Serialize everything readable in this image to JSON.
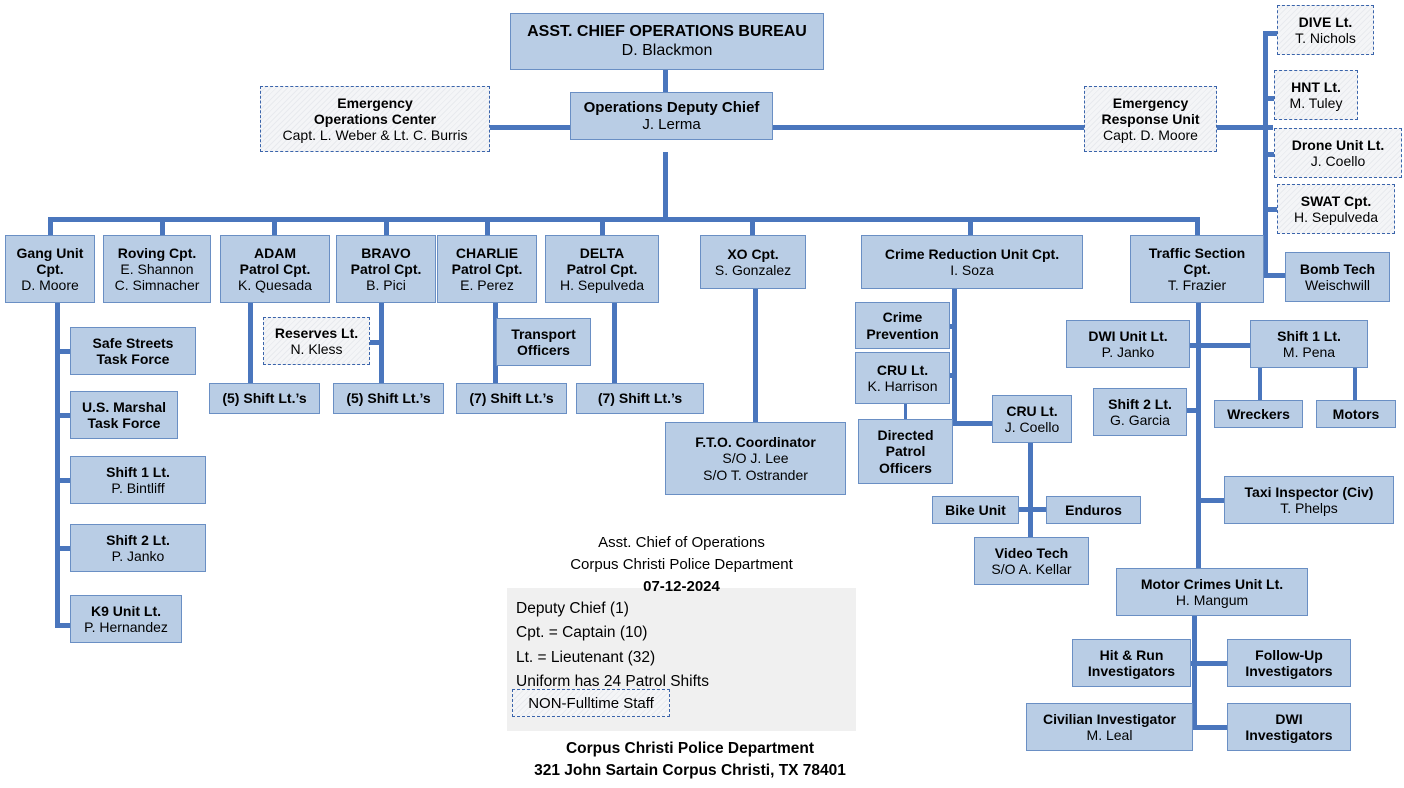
{
  "meta": {
    "colors": {
      "box_fill": "#b9cde5",
      "box_border": "#6a8fc4",
      "line": "#4a76bd",
      "legend_panel": "#f0f0f0",
      "dashed_border": "#3a64ab"
    }
  },
  "chart_data": {
    "type": "diagram",
    "title": "Asst. Chief of Operations Bureau Organizational Chart",
    "nodes": [
      {
        "id": "asst_chief",
        "title": "ASST. CHIEF OPERATIONS BUREAU",
        "name": "D. Blackmon",
        "style": "solid"
      },
      {
        "id": "ops_deputy",
        "title": "Operations Deputy Chief",
        "name": "J. Lerma",
        "style": "solid"
      },
      {
        "id": "eoc",
        "title": "Emergency\nOperations Center",
        "name": "Capt. L. Weber & Lt. C. Burris",
        "style": "dashed"
      },
      {
        "id": "eru",
        "title": "Emergency\nResponse Unit",
        "name": "Capt. D. Moore",
        "style": "dashed"
      },
      {
        "id": "dive",
        "title": "DIVE Lt.",
        "name": "T. Nichols",
        "style": "dashed"
      },
      {
        "id": "hnt",
        "title": "HNT Lt.",
        "name": "M. Tuley",
        "style": "dashed"
      },
      {
        "id": "drone",
        "title": "Drone Unit Lt.",
        "name": "J. Coello",
        "style": "dashed"
      },
      {
        "id": "swat",
        "title": "SWAT Cpt.",
        "name": "H. Sepulveda",
        "style": "dashed"
      },
      {
        "id": "bomb",
        "title": "Bomb Tech",
        "name": "Weischwill",
        "style": "solid"
      },
      {
        "id": "gang",
        "title": "Gang Unit\nCpt.",
        "name": "D. Moore",
        "style": "solid"
      },
      {
        "id": "roving",
        "title": "Roving Cpt.",
        "name": "E. Shannon\nC. Simnacher",
        "style": "solid"
      },
      {
        "id": "adam",
        "title": "ADAM\nPatrol Cpt.",
        "name": "K. Quesada",
        "style": "solid"
      },
      {
        "id": "bravo",
        "title": "BRAVO\nPatrol Cpt.",
        "name": "B. Pici",
        "style": "solid"
      },
      {
        "id": "charlie",
        "title": "CHARLIE\nPatrol Cpt.",
        "name": "E. Perez",
        "style": "solid"
      },
      {
        "id": "delta",
        "title": "DELTA\nPatrol Cpt.",
        "name": "H. Sepulveda",
        "style": "solid"
      },
      {
        "id": "xo",
        "title": "XO Cpt.",
        "name": "S. Gonzalez",
        "style": "solid"
      },
      {
        "id": "cru_cpt",
        "title": "Crime Reduction Unit Cpt.",
        "name": "I. Soza",
        "style": "solid"
      },
      {
        "id": "traffic",
        "title": "Traffic Section\nCpt.",
        "name": "T. Frazier",
        "style": "solid"
      },
      {
        "id": "safe_streets",
        "title": "Safe Streets\nTask Force",
        "name": "",
        "style": "solid"
      },
      {
        "id": "us_marshal",
        "title": "U.S. Marshal\nTask Force",
        "name": "",
        "style": "solid"
      },
      {
        "id": "gang_s1",
        "title": "Shift 1 Lt.",
        "name": "P. Bintliff",
        "style": "solid"
      },
      {
        "id": "gang_s2",
        "title": "Shift 2 Lt.",
        "name": "P. Janko",
        "style": "solid"
      },
      {
        "id": "k9",
        "title": "K9 Unit Lt.",
        "name": "P. Hernandez",
        "style": "solid"
      },
      {
        "id": "reserves",
        "title": "Reserves Lt.",
        "name": "N. Kless",
        "style": "dashed"
      },
      {
        "id": "adam_shifts",
        "title": "(5) Shift Lt.'s",
        "name": "",
        "style": "solid"
      },
      {
        "id": "bravo_shifts",
        "title": "(5) Shift Lt.'s",
        "name": "",
        "style": "solid"
      },
      {
        "id": "charlie_shifts",
        "title": "(7) Shift Lt.'s",
        "name": "",
        "style": "solid"
      },
      {
        "id": "delta_shifts",
        "title": "(7) Shift Lt.'s",
        "name": "",
        "style": "solid"
      },
      {
        "id": "transport",
        "title": "Transport\nOfficers",
        "name": "",
        "style": "solid"
      },
      {
        "id": "fto",
        "title": "F.T.O. Coordinator",
        "name": "S/O J. Lee\nS/O T. Ostrander",
        "style": "solid"
      },
      {
        "id": "crime_prev",
        "title": "Crime\nPrevention",
        "name": "",
        "style": "solid"
      },
      {
        "id": "cru_harrison",
        "title": "CRU Lt.",
        "name": "K. Harrison",
        "style": "solid"
      },
      {
        "id": "directed",
        "title": "Directed\nPatrol\nOfficers",
        "name": "",
        "style": "solid"
      },
      {
        "id": "cru_coello",
        "title": "CRU Lt.",
        "name": "J. Coello",
        "style": "solid"
      },
      {
        "id": "bike",
        "title": "Bike Unit",
        "name": "",
        "style": "solid"
      },
      {
        "id": "enduros",
        "title": "Enduros",
        "name": "",
        "style": "solid"
      },
      {
        "id": "video",
        "title": "Video Tech",
        "name": "S/O A. Kellar",
        "style": "solid"
      },
      {
        "id": "dwi_unit",
        "title": "DWI Unit Lt.",
        "name": "P. Janko",
        "style": "solid"
      },
      {
        "id": "tr_s1",
        "title": "Shift 1 Lt.",
        "name": "M. Pena",
        "style": "solid"
      },
      {
        "id": "tr_s2",
        "title": "Shift 2 Lt.",
        "name": "G. Garcia",
        "style": "solid"
      },
      {
        "id": "wreckers",
        "title": "Wreckers",
        "name": "",
        "style": "solid"
      },
      {
        "id": "motors",
        "title": "Motors",
        "name": "",
        "style": "solid"
      },
      {
        "id": "taxi",
        "title": "Taxi Inspector (Civ)",
        "name": "T. Phelps",
        "style": "solid"
      },
      {
        "id": "motor_crimes",
        "title": "Motor Crimes Unit Lt.",
        "name": "H. Mangum",
        "style": "solid"
      },
      {
        "id": "hit_run",
        "title": "Hit & Run\nInvestigators",
        "name": "",
        "style": "solid"
      },
      {
        "id": "follow_up",
        "title": "Follow-Up\nInvestigators",
        "name": "",
        "style": "solid"
      },
      {
        "id": "civ_inv",
        "title": "Civilian Investigator",
        "name": "M. Leal",
        "style": "solid"
      },
      {
        "id": "dwi_inv",
        "title": "DWI\nInvestigators",
        "name": "",
        "style": "solid"
      }
    ],
    "edges": [
      [
        "asst_chief",
        "ops_deputy"
      ],
      [
        "ops_deputy",
        "eoc"
      ],
      [
        "ops_deputy",
        "eru"
      ],
      [
        "eru",
        "dive"
      ],
      [
        "eru",
        "hnt"
      ],
      [
        "eru",
        "drone"
      ],
      [
        "eru",
        "swat"
      ],
      [
        "eru",
        "bomb"
      ],
      [
        "ops_deputy",
        "gang"
      ],
      [
        "ops_deputy",
        "roving"
      ],
      [
        "ops_deputy",
        "adam"
      ],
      [
        "ops_deputy",
        "bravo"
      ],
      [
        "ops_deputy",
        "charlie"
      ],
      [
        "ops_deputy",
        "delta"
      ],
      [
        "ops_deputy",
        "xo"
      ],
      [
        "ops_deputy",
        "cru_cpt"
      ],
      [
        "ops_deputy",
        "traffic"
      ],
      [
        "gang",
        "safe_streets"
      ],
      [
        "gang",
        "us_marshal"
      ],
      [
        "gang",
        "gang_s1"
      ],
      [
        "gang",
        "gang_s2"
      ],
      [
        "gang",
        "k9"
      ],
      [
        "adam",
        "adam_shifts"
      ],
      [
        "bravo",
        "reserves"
      ],
      [
        "bravo",
        "bravo_shifts"
      ],
      [
        "charlie",
        "transport"
      ],
      [
        "charlie",
        "charlie_shifts"
      ],
      [
        "delta",
        "delta_shifts"
      ],
      [
        "xo",
        "fto"
      ],
      [
        "cru_cpt",
        "crime_prev"
      ],
      [
        "cru_cpt",
        "cru_harrison"
      ],
      [
        "cru_harrison",
        "directed"
      ],
      [
        "cru_cpt",
        "cru_coello"
      ],
      [
        "cru_coello",
        "bike"
      ],
      [
        "cru_coello",
        "enduros"
      ],
      [
        "cru_coello",
        "video"
      ],
      [
        "traffic",
        "dwi_unit"
      ],
      [
        "traffic",
        "tr_s1"
      ],
      [
        "traffic",
        "tr_s2"
      ],
      [
        "traffic",
        "taxi"
      ],
      [
        "tr_s1",
        "wreckers"
      ],
      [
        "tr_s1",
        "motors"
      ],
      [
        "traffic",
        "motor_crimes"
      ],
      [
        "motor_crimes",
        "hit_run"
      ],
      [
        "motor_crimes",
        "follow_up"
      ],
      [
        "motor_crimes",
        "civ_inv"
      ],
      [
        "motor_crimes",
        "dwi_inv"
      ]
    ]
  },
  "boxes": {
    "asst_chief": {
      "title": "ASST. CHIEF OPERATIONS BUREAU",
      "name": "D. Blackmon"
    },
    "ops_deputy": {
      "title": "Operations Deputy Chief",
      "name": "J. Lerma"
    },
    "eoc": {
      "title1": "Emergency",
      "title2": "Operations Center",
      "name": "Capt. L. Weber & Lt. C. Burris"
    },
    "eru": {
      "title1": "Emergency",
      "title2": "Response Unit",
      "name": "Capt. D. Moore"
    },
    "dive": {
      "title": "DIVE Lt.",
      "name": "T. Nichols"
    },
    "hnt": {
      "title": "HNT Lt.",
      "name": "M. Tuley"
    },
    "drone": {
      "title": "Drone Unit Lt.",
      "name": "J. Coello"
    },
    "swat": {
      "title": "SWAT Cpt.",
      "name": "H. Sepulveda"
    },
    "bomb": {
      "title": "Bomb Tech",
      "name": "Weischwill"
    },
    "gang": {
      "title1": "Gang Unit",
      "title2": "Cpt.",
      "name": "D. Moore"
    },
    "roving": {
      "title": "Roving Cpt.",
      "name1": "E. Shannon",
      "name2": "C. Simnacher"
    },
    "adam": {
      "title1": "ADAM",
      "title2": "Patrol Cpt.",
      "name": "K. Quesada"
    },
    "bravo": {
      "title1": "BRAVO",
      "title2": "Patrol Cpt.",
      "name": "B. Pici"
    },
    "charlie": {
      "title1": "CHARLIE",
      "title2": "Patrol Cpt.",
      "name": "E. Perez"
    },
    "delta": {
      "title1": "DELTA",
      "title2": "Patrol Cpt.",
      "name": "H. Sepulveda"
    },
    "xo": {
      "title": "XO Cpt.",
      "name": "S. Gonzalez"
    },
    "cru_cpt": {
      "title": "Crime Reduction Unit Cpt.",
      "name": "I. Soza"
    },
    "traffic": {
      "title1": "Traffic Section",
      "title2": "Cpt.",
      "name": "T. Frazier"
    },
    "safe_streets": {
      "title1": "Safe Streets",
      "title2": "Task Force"
    },
    "us_marshal": {
      "title1": "U.S. Marshal",
      "title2": "Task Force"
    },
    "gang_s1": {
      "title": "Shift 1 Lt.",
      "name": "P. Bintliff"
    },
    "gang_s2": {
      "title": "Shift 2 Lt.",
      "name": "P. Janko"
    },
    "k9": {
      "title": "K9 Unit Lt.",
      "name": "P. Hernandez"
    },
    "reserves": {
      "title": "Reserves Lt.",
      "name": "N. Kless"
    },
    "adam_shifts": {
      "title": "(5) Shift Lt.’s"
    },
    "bravo_shifts": {
      "title": "(5) Shift Lt.’s"
    },
    "charlie_shifts": {
      "title": "(7) Shift Lt.’s"
    },
    "delta_shifts": {
      "title": "(7) Shift Lt.’s"
    },
    "transport": {
      "title1": "Transport",
      "title2": "Officers"
    },
    "fto": {
      "title": "F.T.O. Coordinator",
      "name1": "S/O J. Lee",
      "name2": "S/O T. Ostrander"
    },
    "crime_prev": {
      "title1": "Crime",
      "title2": "Prevention"
    },
    "cru_harrison": {
      "title": "CRU Lt.",
      "name": "K. Harrison"
    },
    "directed": {
      "title1": "Directed",
      "title2": "Patrol",
      "title3": "Officers"
    },
    "cru_coello": {
      "title": "CRU Lt.",
      "name": "J. Coello"
    },
    "bike": {
      "title": "Bike Unit"
    },
    "enduros": {
      "title": "Enduros"
    },
    "video": {
      "title": "Video Tech",
      "name": "S/O A. Kellar"
    },
    "dwi_unit": {
      "title": "DWI Unit Lt.",
      "name": "P. Janko"
    },
    "tr_s1": {
      "title": "Shift 1 Lt.",
      "name": "M. Pena"
    },
    "tr_s2": {
      "title": "Shift 2 Lt.",
      "name": "G. Garcia"
    },
    "wreckers": {
      "title": "Wreckers"
    },
    "motors": {
      "title": "Motors"
    },
    "taxi": {
      "title": "Taxi Inspector (Civ)",
      "name": "T. Phelps"
    },
    "motor_crimes": {
      "title": "Motor Crimes Unit Lt.",
      "name": "H. Mangum"
    },
    "hit_run": {
      "title1": "Hit & Run",
      "title2": "Investigators"
    },
    "follow_up": {
      "title1": "Follow-Up",
      "title2": "Investigators"
    },
    "civ_inv": {
      "title": "Civilian Investigator",
      "name": "M. Leal"
    },
    "dwi_inv": {
      "title1": "DWI",
      "title2": "Investigators"
    }
  },
  "caption": {
    "line1": "Asst. Chief of Operations",
    "line2": "Corpus Christi Police Department",
    "date": "07-12-2024"
  },
  "legend": {
    "items": [
      "Deputy Chief (1)",
      "Cpt. = Captain (10)",
      "Lt. = Lieutenant (32)",
      "Uniform has 24 Patrol Shifts"
    ],
    "key_label": "NON-Fulltime Staff"
  },
  "footer": {
    "line1": "Corpus Christi Police Department",
    "line2": "321 John Sartain Corpus Christi, TX 78401"
  }
}
